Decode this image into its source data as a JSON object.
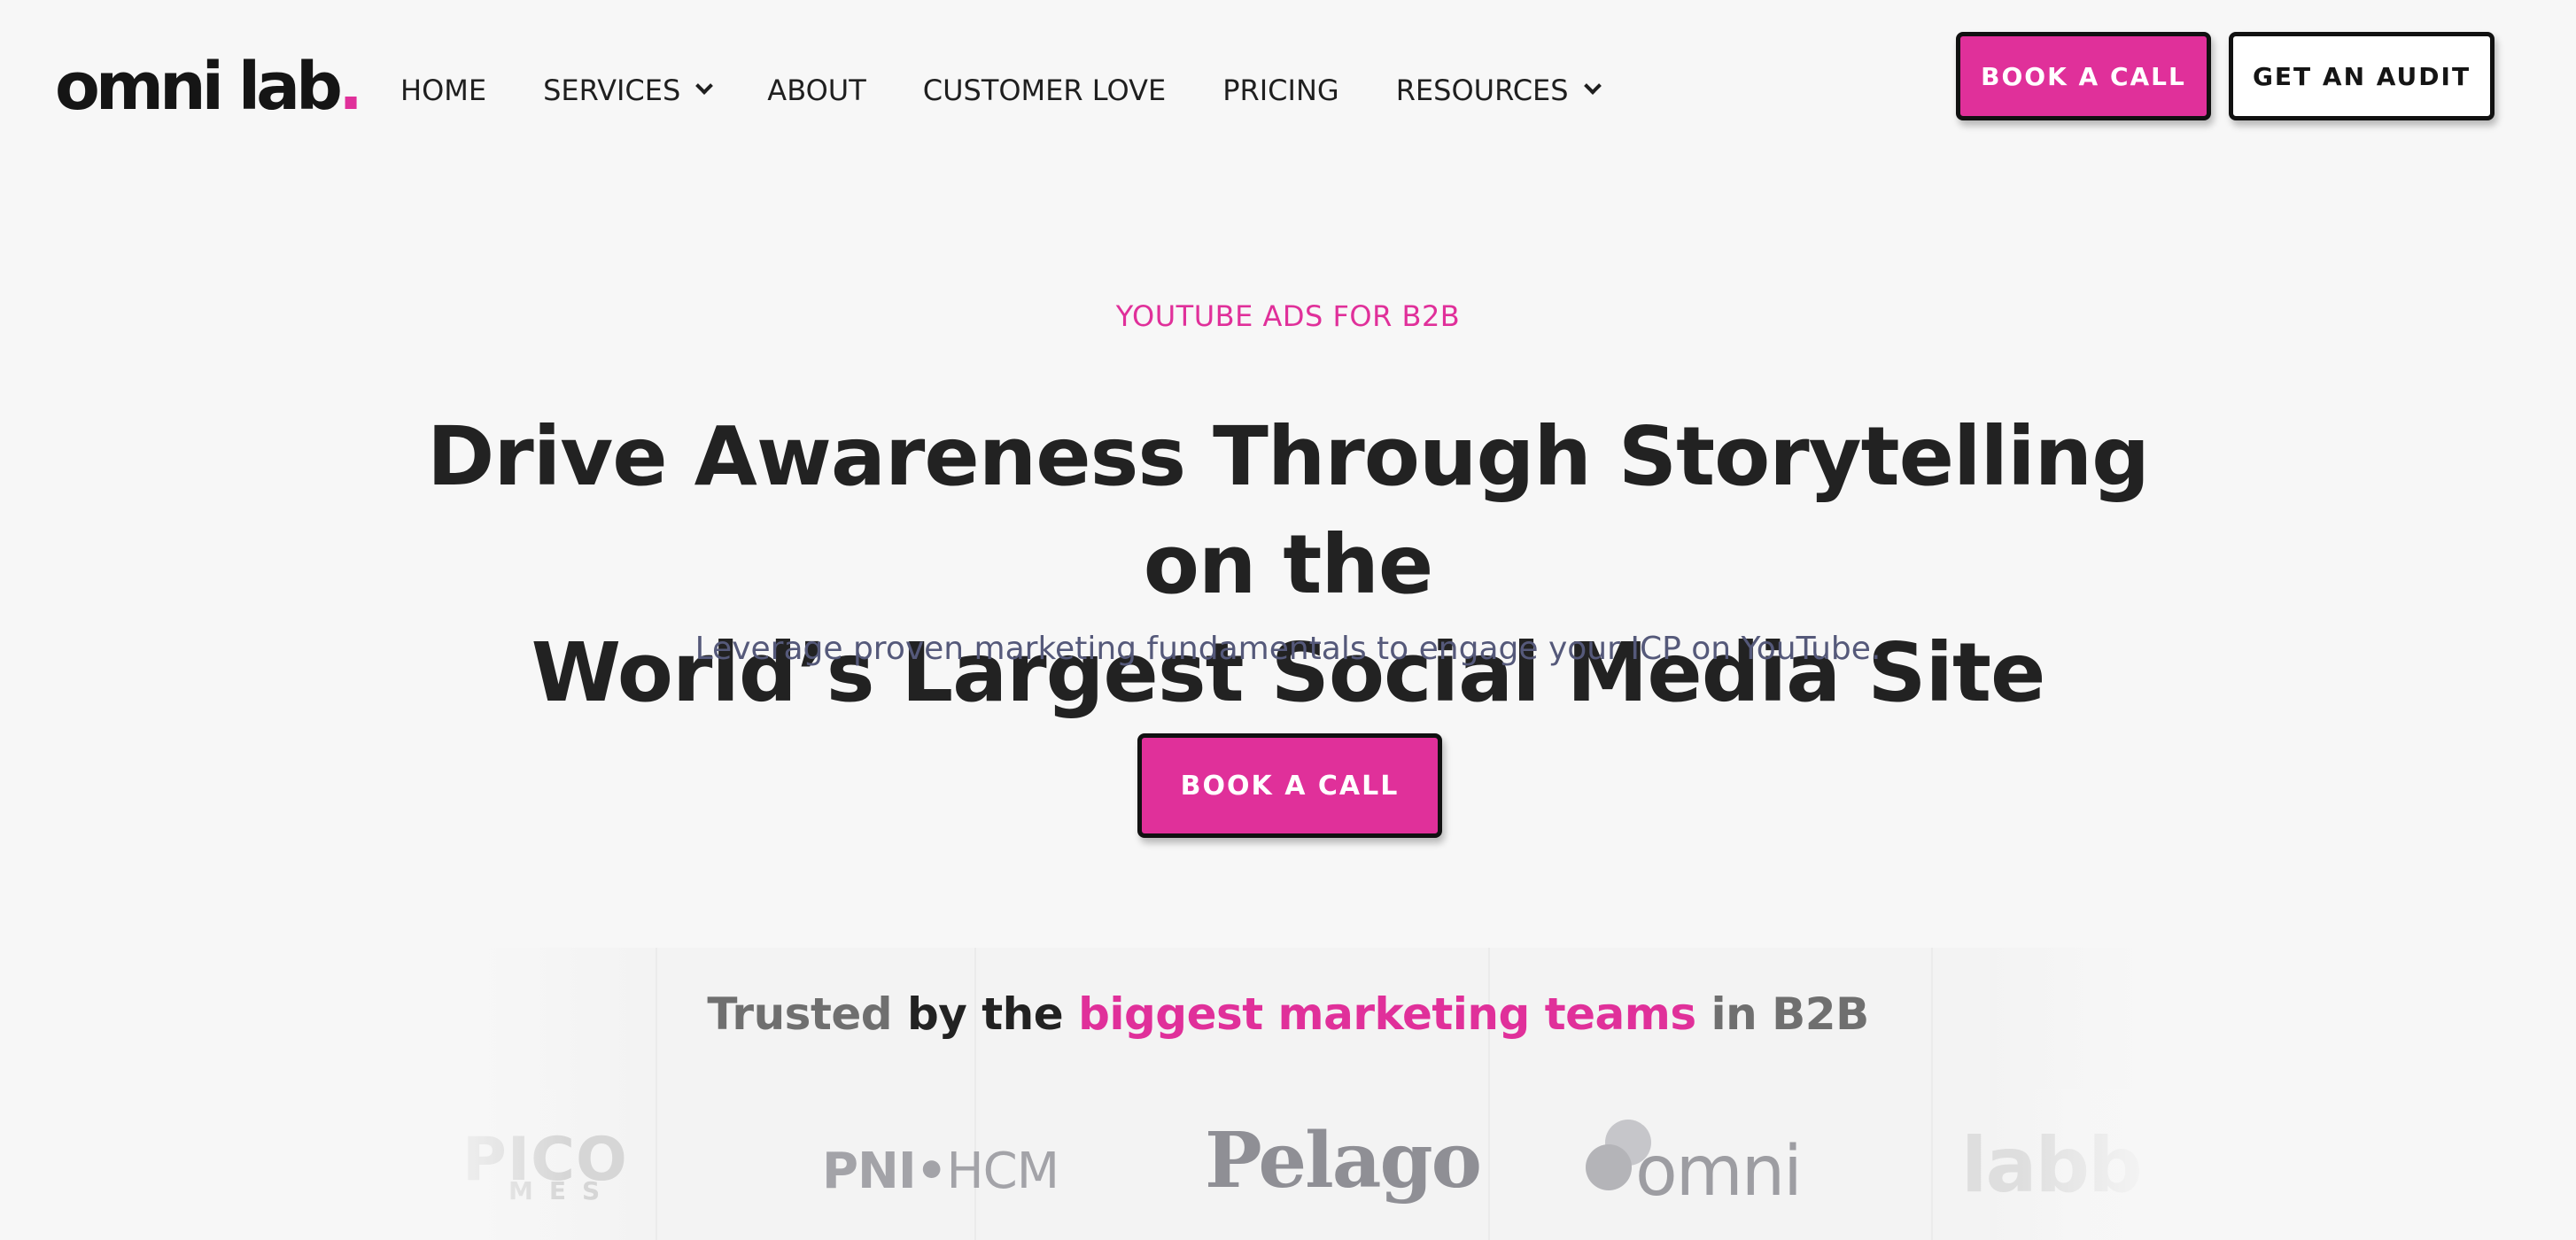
{
  "brand": {
    "logo_text": "omni lab",
    "logo_dot": ".",
    "accent": "#e0309a"
  },
  "nav": {
    "items": [
      {
        "label": "HOME",
        "has_dropdown": false
      },
      {
        "label": "SERVICES",
        "has_dropdown": true
      },
      {
        "label": "ABOUT",
        "has_dropdown": false
      },
      {
        "label": "CUSTOMER LOVE",
        "has_dropdown": false
      },
      {
        "label": "PRICING",
        "has_dropdown": false
      },
      {
        "label": "RESOURCES",
        "has_dropdown": true
      }
    ],
    "cta_primary": "BOOK A CALL",
    "cta_secondary": "GET AN AUDIT"
  },
  "hero": {
    "eyebrow": "YOUTUBE ADS FOR B2B",
    "headline_line1": "Drive Awareness Through Storytelling on the",
    "headline_line2": "World’s Largest Social Media Site",
    "subhead": "Leverage proven marketing fundamentals to engage your ICP on YouTube.",
    "cta": "BOOK A CALL"
  },
  "trusted": {
    "part1": "Trusted",
    "part2": " by the ",
    "part3": "biggest marketing teams",
    "part4": " in B2B"
  },
  "logos": {
    "pico": "PICO",
    "pico_sub": "MES",
    "pnl_bold": "PNI•",
    "pnl_light": "HCM",
    "pelago": "Pelago",
    "omni": "omni",
    "labb": "labb"
  }
}
